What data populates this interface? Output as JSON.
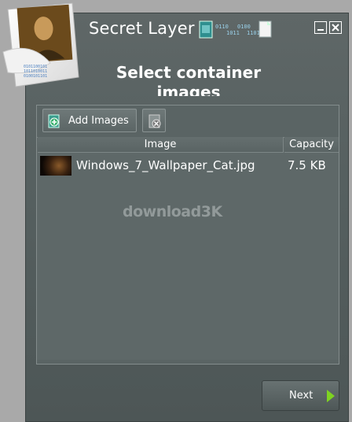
{
  "window": {
    "title": "Secret Layer",
    "minimize_icon": "minimize-icon",
    "close_icon": "close-icon"
  },
  "page": {
    "heading": "Select container images"
  },
  "toolbar": {
    "add_images_label": "Add Images",
    "add_icon": "add-image-icon",
    "remove_icon": "remove-image-icon"
  },
  "table": {
    "columns": [
      "Image",
      "Capacity"
    ],
    "rows": [
      {
        "name": "Windows_7_Wallpaper_Cat.jpg",
        "capacity": "7.5 KB"
      }
    ]
  },
  "watermark": {
    "text": "download3K"
  },
  "footer": {
    "next_label": "Next"
  },
  "colors": {
    "background": "#a9a9a9",
    "window": "#566060",
    "accent_arrow": "#7ed321"
  }
}
